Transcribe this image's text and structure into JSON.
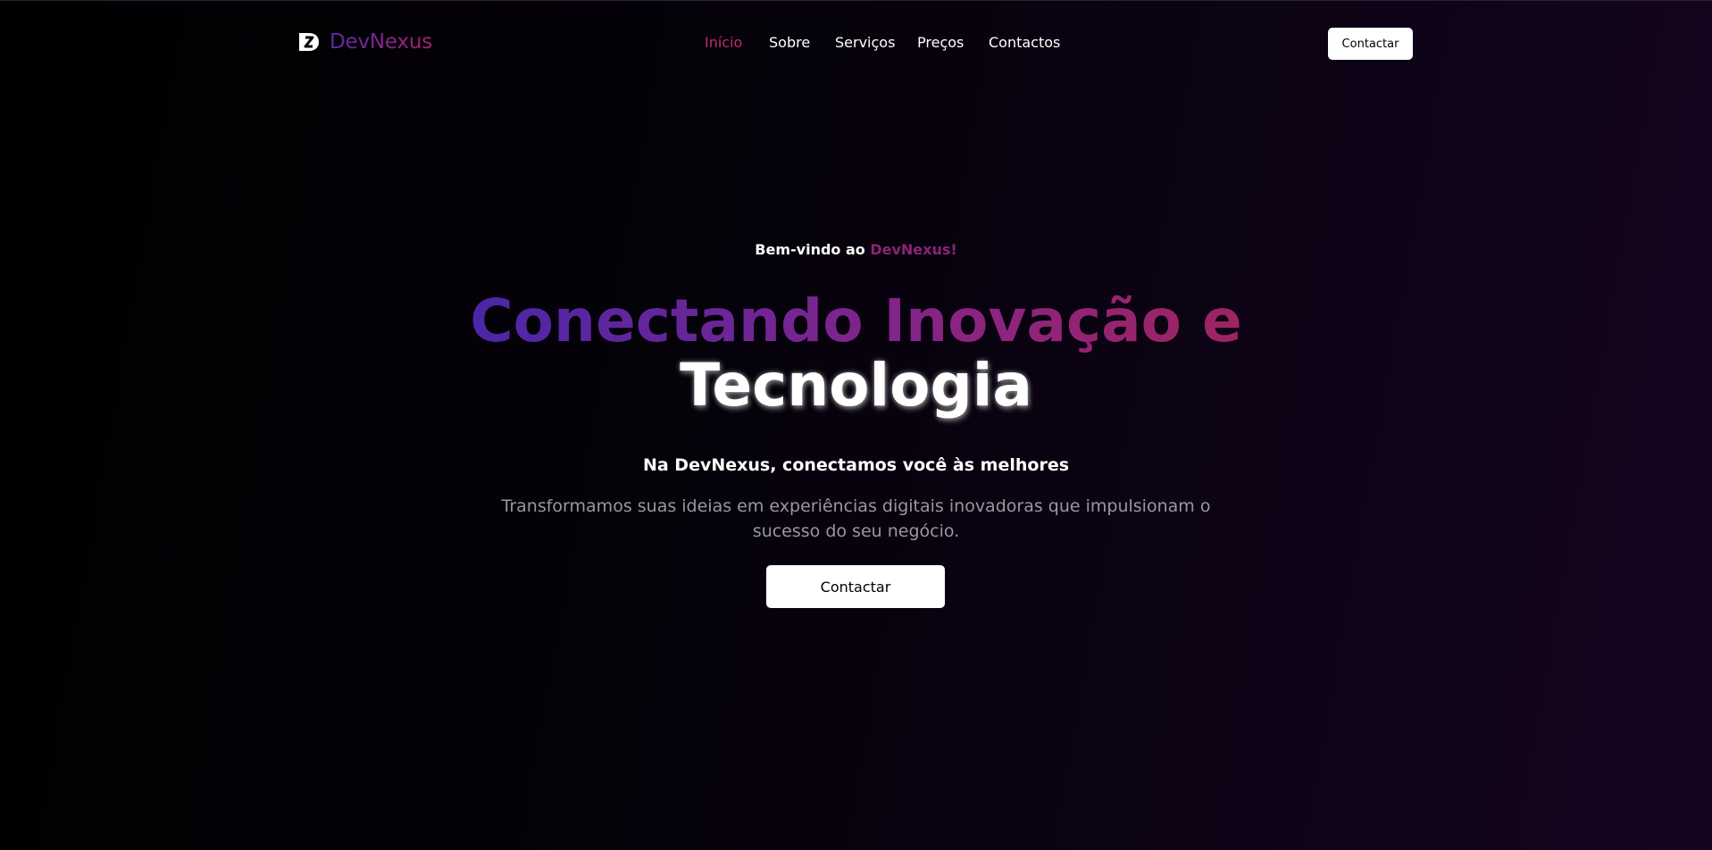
{
  "brand": {
    "name": "DevNexus",
    "icon": "devnexus-logo-icon"
  },
  "nav": {
    "links": [
      {
        "label": "Início",
        "active": true
      },
      {
        "label": "Sobre",
        "active": false
      },
      {
        "label": "Serviços",
        "active": false
      },
      {
        "label": "Preços",
        "active": false
      },
      {
        "label": "Contactos",
        "active": false
      }
    ],
    "cta_label": "Contactar"
  },
  "hero": {
    "welcome_prefix": "Bem-vindo ao",
    "welcome_brand": "DevNexus!",
    "headline_line1": "Conectando Inovação e",
    "headline_line2": "Tecnologia",
    "subtitle": "Na DevNexus, conectamos você às  melhores",
    "description": "Transformamos suas ideias em experiências digitais inovadoras que impulsionam o sucesso do seu negócio.",
    "cta_label": "Contactar"
  },
  "colors": {
    "active_link": "#c42a6b",
    "brand_purple": "#5b2aa8",
    "brand_magenta": "#a3246d",
    "background": "#000000"
  }
}
